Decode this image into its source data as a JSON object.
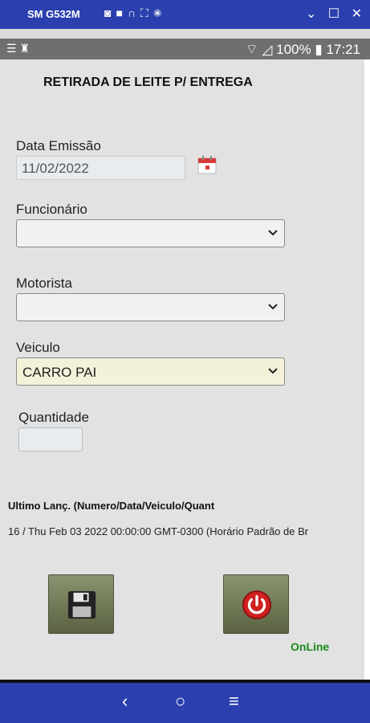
{
  "window": {
    "title": "SM G532M",
    "icons": [
      "camera-icon",
      "video-icon",
      "headset-icon",
      "expand-icon",
      "settings-icon"
    ],
    "controls": {
      "minimize": "⌄",
      "maximize": "☐",
      "close": "✕"
    }
  },
  "status_bar": {
    "left_glyphs": "☰ ♜",
    "battery": "100%",
    "time": "17:21"
  },
  "form": {
    "title": "RETIRADA DE LEITE P/ ENTREGA",
    "data_emissao_label": "Data Emissão",
    "data_emissao_value": "11/02/2022",
    "funcionario_label": "Funcionário",
    "funcionario_value": "",
    "motorista_label": "Motorista",
    "motorista_value": "",
    "veiculo_label": "Veiculo",
    "veiculo_value": "CARRO PAI",
    "quantidade_label": "Quantidade",
    "quantidade_value": ""
  },
  "last_entry": {
    "label": "Ultimo Lanç. (Numero/Data/Veiculo/Quant",
    "value": "16 / Thu Feb 03 2022 00:00:00 GMT-0300 (Horário Padrão de Br"
  },
  "actions": {
    "save_icon": "floppy-disk-icon",
    "power_icon": "power-icon",
    "status": "OnLine"
  },
  "colors": {
    "window_bar": "#2b3fae",
    "veiculo_bg": "#f3f2d9",
    "online": "#1a8a1a",
    "button": "#737b58",
    "power": "#d02020"
  },
  "nav": {
    "back": "‹",
    "home": "○",
    "menu": "≡"
  }
}
